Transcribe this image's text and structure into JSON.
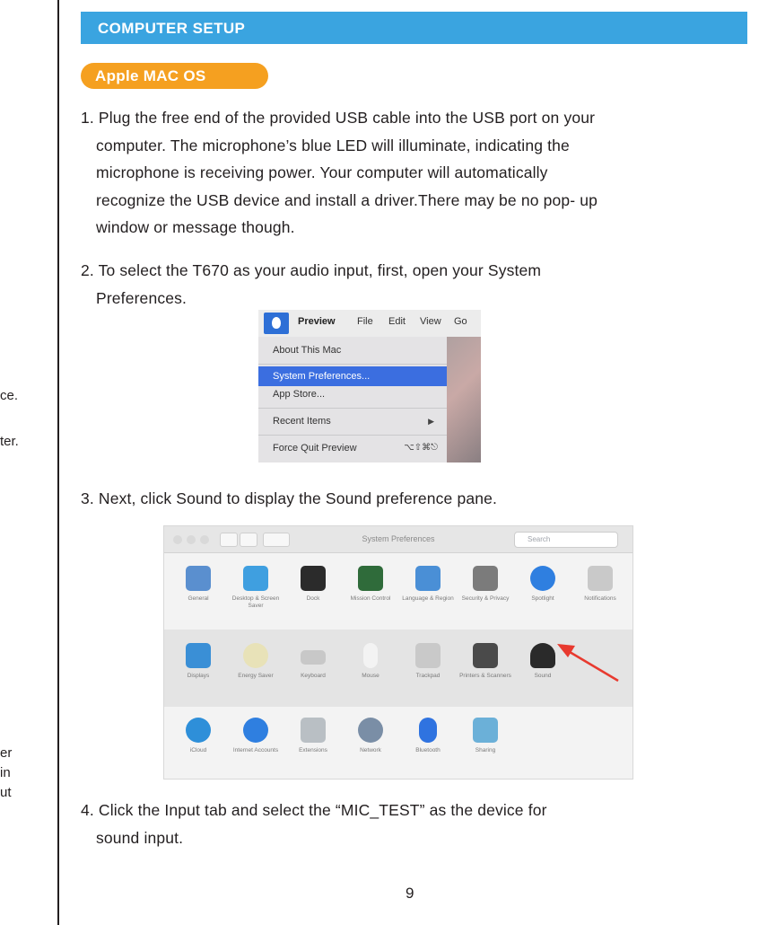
{
  "left_fragments": [
    "ce.",
    "ter.",
    "er",
    "in",
    "ut"
  ],
  "header": {
    "title": "COMPUTER SETUP",
    "bar_color": "#3aa4e0"
  },
  "os_badge": {
    "label": "Apple MAC OS",
    "color": "#f5a020"
  },
  "steps": {
    "step1": [
      "1. Plug the free end of the provided USB cable into the USB port on your",
      "computer. The microphone’s blue LED will illuminate, indicating the",
      "microphone is receiving power. Your computer will automatically",
      "recognize the USB device and install a driver.There may be no pop- up",
      "window or message though."
    ],
    "step2": [
      "2. To select the T670 as your audio input, first, open your System",
      "Preferences."
    ],
    "step3": [
      "3. Next, click Sound to display the Sound preference pane."
    ],
    "step4": [
      "4. Click the Input tab and select the “MIC_TEST” as the device for",
      "sound input."
    ]
  },
  "apple_menu": {
    "menubar": [
      "Preview",
      "File",
      "Edit",
      "View",
      "Go"
    ],
    "items": [
      "About This Mac",
      "System Preferences...",
      "App Store...",
      "Recent Items",
      "Force Quit Preview"
    ],
    "force_quit_shortcut": "⌥⇧⌘⎋",
    "highlighted": "System Preferences..."
  },
  "system_preferences": {
    "window_title": "System Preferences",
    "search_placeholder": "Search",
    "rows": [
      [
        {
          "label": "General",
          "icon": "general-icon",
          "color": "#5a8fcf"
        },
        {
          "label": "Desktop & Screen Saver",
          "icon": "desktop-icon",
          "color": "#3f9fe0"
        },
        {
          "label": "Dock",
          "icon": "dock-icon",
          "color": "#2b2b2b"
        },
        {
          "label": "Mission Control",
          "icon": "mission-control-icon",
          "color": "#2f6b3a"
        },
        {
          "label": "Language & Region",
          "icon": "language-icon",
          "color": "#4a8fd6"
        },
        {
          "label": "Security & Privacy",
          "icon": "security-icon",
          "color": "#7b7b7b"
        },
        {
          "label": "Spotlight",
          "icon": "spotlight-icon",
          "color": "#2f7fe0"
        },
        {
          "label": "Notifications",
          "icon": "notifications-icon",
          "color": "#c9c9c9"
        }
      ],
      [
        {
          "label": "Displays",
          "icon": "displays-icon",
          "color": "#3a8fd6"
        },
        {
          "label": "Energy Saver",
          "icon": "energy-icon",
          "color": "#e8e2b8"
        },
        {
          "label": "Keyboard",
          "icon": "keyboard-icon",
          "color": "#c8c8c8"
        },
        {
          "label": "Mouse",
          "icon": "mouse-icon",
          "color": "#f3f3f3"
        },
        {
          "label": "Trackpad",
          "icon": "trackpad-icon",
          "color": "#c9c9c9"
        },
        {
          "label": "Printers & Scanners",
          "icon": "printer-icon",
          "color": "#4a4a4a"
        },
        {
          "label": "Sound",
          "icon": "sound-icon",
          "color": "#2a2a2a"
        }
      ],
      [
        {
          "label": "iCloud",
          "icon": "icloud-icon",
          "color": "#2e8fd9"
        },
        {
          "label": "Internet Accounts",
          "icon": "internet-accounts-icon",
          "color": "#2f7fe0"
        },
        {
          "label": "Extensions",
          "icon": "extensions-icon",
          "color": "#b9bfc4"
        },
        {
          "label": "Network",
          "icon": "network-icon",
          "color": "#7a8ea6"
        },
        {
          "label": "Bluetooth",
          "icon": "bluetooth-icon",
          "color": "#2f73e0"
        },
        {
          "label": "Sharing",
          "icon": "sharing-icon",
          "color": "#6bb0d8"
        }
      ]
    ],
    "arrow_color": "#e83a2f"
  },
  "page_number": "9"
}
